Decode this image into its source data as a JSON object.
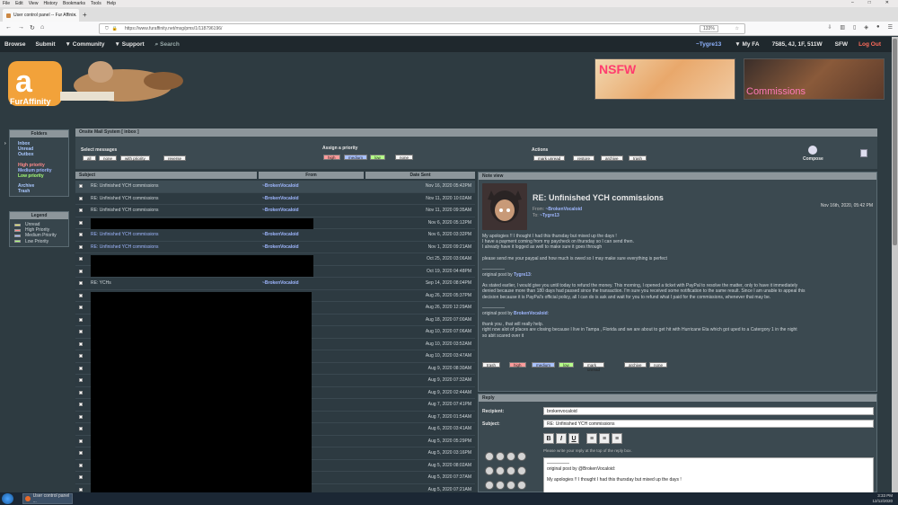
{
  "browser": {
    "menu": [
      "File",
      "Edit",
      "View",
      "History",
      "Bookmarks",
      "Tools",
      "Help"
    ],
    "tab_title": "User control panel -- Fur Affini...",
    "url": "https://www.furaffinity.net/msg/pms/1/118796196/",
    "zoom": "133%"
  },
  "site_nav": {
    "browse": "Browse",
    "submit": "Submit",
    "community": "▼ Community",
    "support": "▼ Support",
    "search": "Search",
    "user": "~Tygre13",
    "myfa": "▼ My FA",
    "stats": "7585, 4J, 1F, 511W",
    "sfw": "SFW",
    "logout": "Log Out"
  },
  "logo_text": "FurAffinity",
  "banners": {
    "nsfw": "NSFW",
    "commissions": "Commissions"
  },
  "folders": {
    "title": "Folders",
    "inbox": "Inbox",
    "unread": "Unread",
    "outbox": "Outbox",
    "high": "High priority",
    "medium": "Medium priority",
    "low": "Low priority",
    "archive": "Archive",
    "trash": "Trash"
  },
  "legend": {
    "title": "Legend",
    "items": [
      {
        "label": "Unread",
        "color": "#e8e86a"
      },
      {
        "label": "High Priority",
        "color": "#ff8a8a"
      },
      {
        "label": "Medium Priority",
        "color": "#9fb7ff"
      },
      {
        "label": "Low Priority",
        "color": "#a6ff75"
      }
    ]
  },
  "mail": {
    "header": "Onsite Mail System [ inbox ]",
    "select_label": "Select messages",
    "select": [
      "all",
      "none",
      "with priority",
      "reverse"
    ],
    "priority_label": "Assign a priority",
    "priority": [
      "high",
      "medium",
      "low",
      "none"
    ],
    "actions_label": "Actions",
    "actions": [
      "mark unread",
      "restore",
      "archive",
      "trash"
    ],
    "compose": "Compose"
  },
  "list": {
    "columns": {
      "subject": "Subject",
      "from": "From",
      "date": "Date Sent"
    },
    "rows": [
      {
        "subject": "RE: Unfinished YCH commissions",
        "from": "~BrokenVocaloid",
        "date": "Nov 16, 2020 05:42PM"
      },
      {
        "subject": "RE: Unfinished YCH commissions",
        "from": "~BrokenVocaloid",
        "date": "Nov 11, 2020 10:02AM"
      },
      {
        "subject": "RE: Unfinished YCH commissions",
        "from": "~BrokenVocaloid",
        "date": "Nov 11, 2020 09:35AM"
      },
      {
        "subject": "",
        "from": "",
        "date": "Nov 6, 2020 05:12PM"
      },
      {
        "subject": "RE: Unfinished YCH commissions",
        "from": "~BrokenVocaloid",
        "date": "Nov 6, 2020 03:32PM"
      },
      {
        "subject": "RE: Unfinished YCH commissions",
        "from": "~BrokenVocaloid",
        "date": "Nov 1, 2020 09:21AM"
      },
      {
        "subject": "",
        "from": "",
        "date": "Oct 25, 2020 03:06AM"
      },
      {
        "subject": "",
        "from": "",
        "date": "Oct 19, 2020 04:48PM"
      },
      {
        "subject": "RE: YCHs",
        "from": "~BrokenVocaloid",
        "date": "Sep 14, 2020 08:04PM"
      },
      {
        "subject": "",
        "from": "",
        "date": "Aug 26, 2020 05:37PM"
      },
      {
        "subject": "",
        "from": "",
        "date": "Aug 26, 2020 12:29AM"
      },
      {
        "subject": "",
        "from": "",
        "date": "Aug 18, 2020 07:00AM"
      },
      {
        "subject": "",
        "from": "",
        "date": "Aug 10, 2020 07:06AM"
      },
      {
        "subject": "",
        "from": "",
        "date": "Aug 10, 2020 03:52AM"
      },
      {
        "subject": "",
        "from": "",
        "date": "Aug 10, 2020 03:47AM"
      },
      {
        "subject": "",
        "from": "",
        "date": "Aug 9, 2020 08:30AM"
      },
      {
        "subject": "",
        "from": "",
        "date": "Aug 9, 2020 07:32AM"
      },
      {
        "subject": "",
        "from": "",
        "date": "Aug 9, 2020 02:44AM"
      },
      {
        "subject": "",
        "from": "",
        "date": "Aug 7, 2020 07:41PM"
      },
      {
        "subject": "",
        "from": "",
        "date": "Aug 7, 2020 01:54AM"
      },
      {
        "subject": "",
        "from": "",
        "date": "Aug 6, 2020 03:41AM"
      },
      {
        "subject": "",
        "from": "",
        "date": "Aug 5, 2020 05:29PM"
      },
      {
        "subject": "",
        "from": "",
        "date": "Aug 5, 2020 03:16PM"
      },
      {
        "subject": "",
        "from": "",
        "date": "Aug 5, 2020 08:02AM"
      },
      {
        "subject": "",
        "from": "",
        "date": "Aug 5, 2020 07:37AM"
      },
      {
        "subject": "",
        "from": "",
        "date": "Aug 5, 2020 07:21AM"
      }
    ]
  },
  "note": {
    "header": "Note view",
    "title": "RE: Unfinished YCH commissions",
    "from_label": "From:",
    "from": "~BrokenVocaloid",
    "to_label": "To:",
    "to": "~Tygre13",
    "date": "Nov 16th, 2020, 05:42 PM",
    "l1": "My apologies !! I thought I had this thursday but mixed up the days !",
    "l2": "I have a payment coming from my paycheck on thursday so I can send then.",
    "l3": "I already have it logged as well to make sure it goes through",
    "l4": "please send me your paypal and how much is owed so I may make sure everything is perfect",
    "sep1": "—————",
    "orig1": "original post by",
    "orig1_user": "Tygre13",
    "l5": "As stated earlier, I would give you until today to refund the money. This morning, I opened a ticket with PayPal to resolve the matter, only to have it immediately",
    "l6": "denied because more than 180 days had passed since the transaction. I'm sure you received some notification to the same result. Since I am unable to appeal this",
    "l7": "decision because it is PayPal's official policy, all I can do is ask and wait for you to refund what I paid for the commissions, whenever that may be.",
    "sep2": "—————",
    "orig2": "original post by",
    "orig2_user": "BrokenVocaloid",
    "l8": "thank you , that will really help.",
    "l9": "right now alot of places are closing because I live in Tampa , Florida and we are about to get hit with Hurricane Eta which got uped to a Catergory 1 in the night",
    "l10": "so abit scared over it",
    "actions": [
      "trash",
      "high",
      "medium",
      "low",
      "mark unread",
      "archive",
      "none"
    ]
  },
  "reply": {
    "header": "Reply",
    "recipient_label": "Recipient:",
    "recipient": "brokenvocaloid",
    "subject_label": "Subject:",
    "subject": "RE: Unfinished YCH commissions",
    "hint": "Please write your reply at the top of the reply box.",
    "sep": "—————",
    "orig": "original post by @BrokenVocaloid:",
    "first_line": "My apologies !! I thought I had this thursday but mixed up the days !"
  },
  "taskbar": {
    "app": "User control panel ...",
    "time": "3:33 PM",
    "date": "12/12/2020"
  }
}
